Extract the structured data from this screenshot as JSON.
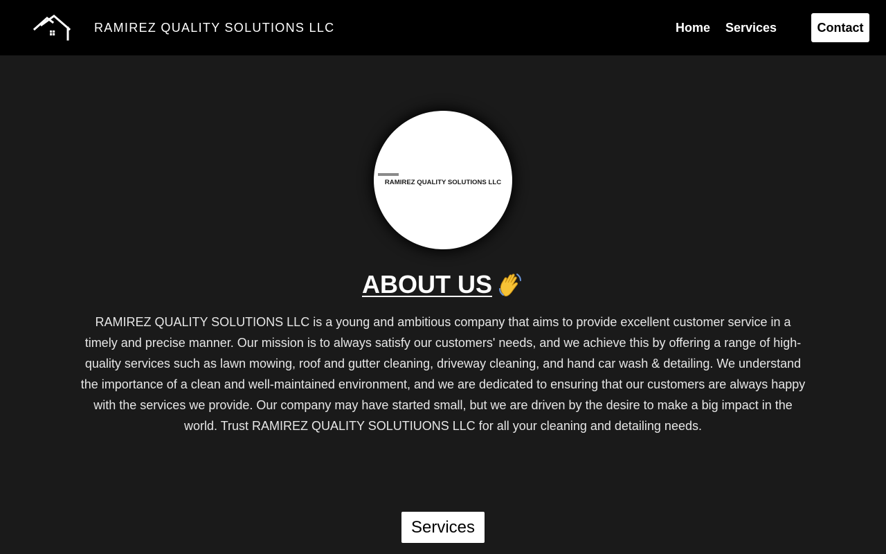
{
  "header": {
    "brand_name": "RAMIREZ QUALITY SOLUTIONS LLC",
    "logo_icon": "house-roof-icon",
    "nav": {
      "home_label": "Home",
      "services_label": "Services",
      "contact_label": "Contact"
    }
  },
  "profile": {
    "image_text": "RAMIREZ QUALITY SOLUTIONS LLC"
  },
  "about": {
    "heading": "ABOUT US",
    "heading_emoji_icon": "waving-hand-icon",
    "body": "RAMIREZ QUALITY SOLUTIONS LLC is a young and ambitious company that aims to provide excellent customer service in a timely and precise manner. Our mission is to always satisfy our customers' needs, and we achieve this by offering a range of high-quality services such as lawn mowing, roof and gutter cleaning, driveway cleaning, and hand car wash & detailing. We understand the importance of a clean and well-maintained environment, and we are dedicated to ensuring that our customers are always happy with the services we provide. Our company may have started small, but we are driven by the desire to make a big impact in the world. Trust RAMIREZ QUALITY SOLUTIUONS LLC for all your cleaning and detailing needs."
  },
  "cta": {
    "services_label": "Services"
  },
  "colors": {
    "header_bg": "#000000",
    "page_bg": "#1a1a1a",
    "text": "#ffffff",
    "button_bg": "#ffffff"
  }
}
